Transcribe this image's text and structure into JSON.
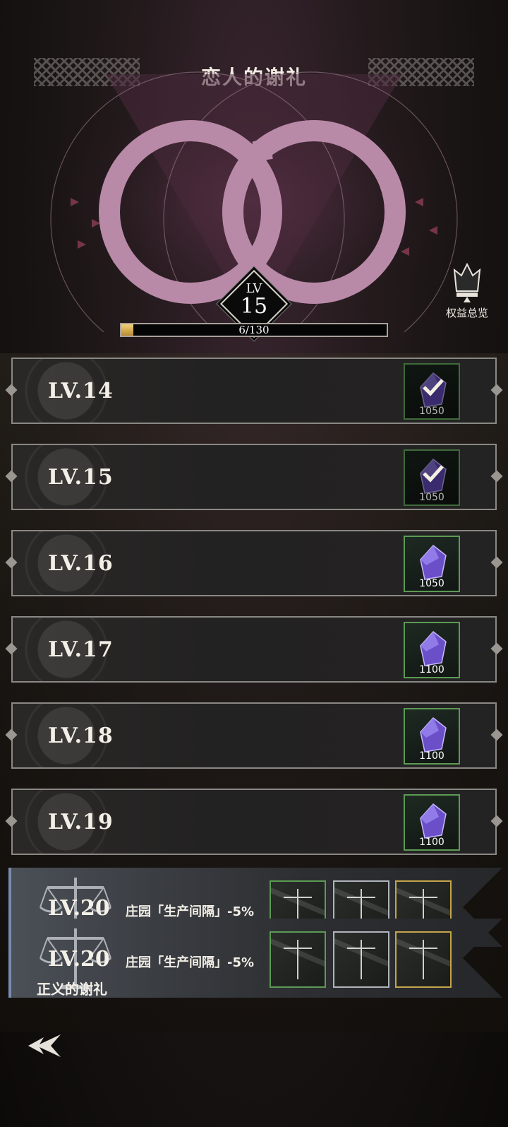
{
  "header": {
    "title": "恋人的谢礼",
    "level_label": "LV",
    "level_value": "15",
    "progress_text": "6/130",
    "progress_fraction": 0.046,
    "benefit_label": "权益总览"
  },
  "rows": [
    {
      "level": "LV.14",
      "reward_qty": "1050",
      "claimed": true
    },
    {
      "level": "LV.15",
      "reward_qty": "1050",
      "claimed": true
    },
    {
      "level": "LV.16",
      "reward_qty": "1050",
      "claimed": false
    },
    {
      "level": "LV.17",
      "reward_qty": "1100",
      "claimed": false
    },
    {
      "level": "LV.18",
      "reward_qty": "1100",
      "claimed": false
    },
    {
      "level": "LV.19",
      "reward_qty": "1100",
      "claimed": false
    }
  ],
  "milestones": [
    {
      "level": "LV.20",
      "effect": "庄园「生产间隔」-5%",
      "subtitle": ""
    },
    {
      "level": "LV.20",
      "effect": "庄园「生产间隔」-5%",
      "subtitle": "正义的谢礼"
    }
  ],
  "icons": {
    "reward": "crystal-gem-icon",
    "claimed": "check-icon",
    "milestone": "scales-icon",
    "back": "back-arrow-icon",
    "benefit": "crown-icon"
  },
  "colors": {
    "ring": "#b98aa8",
    "claimed_border": "#3f6a3a",
    "available_border": "#5c9a54",
    "gold_border": "#c4a54a"
  }
}
